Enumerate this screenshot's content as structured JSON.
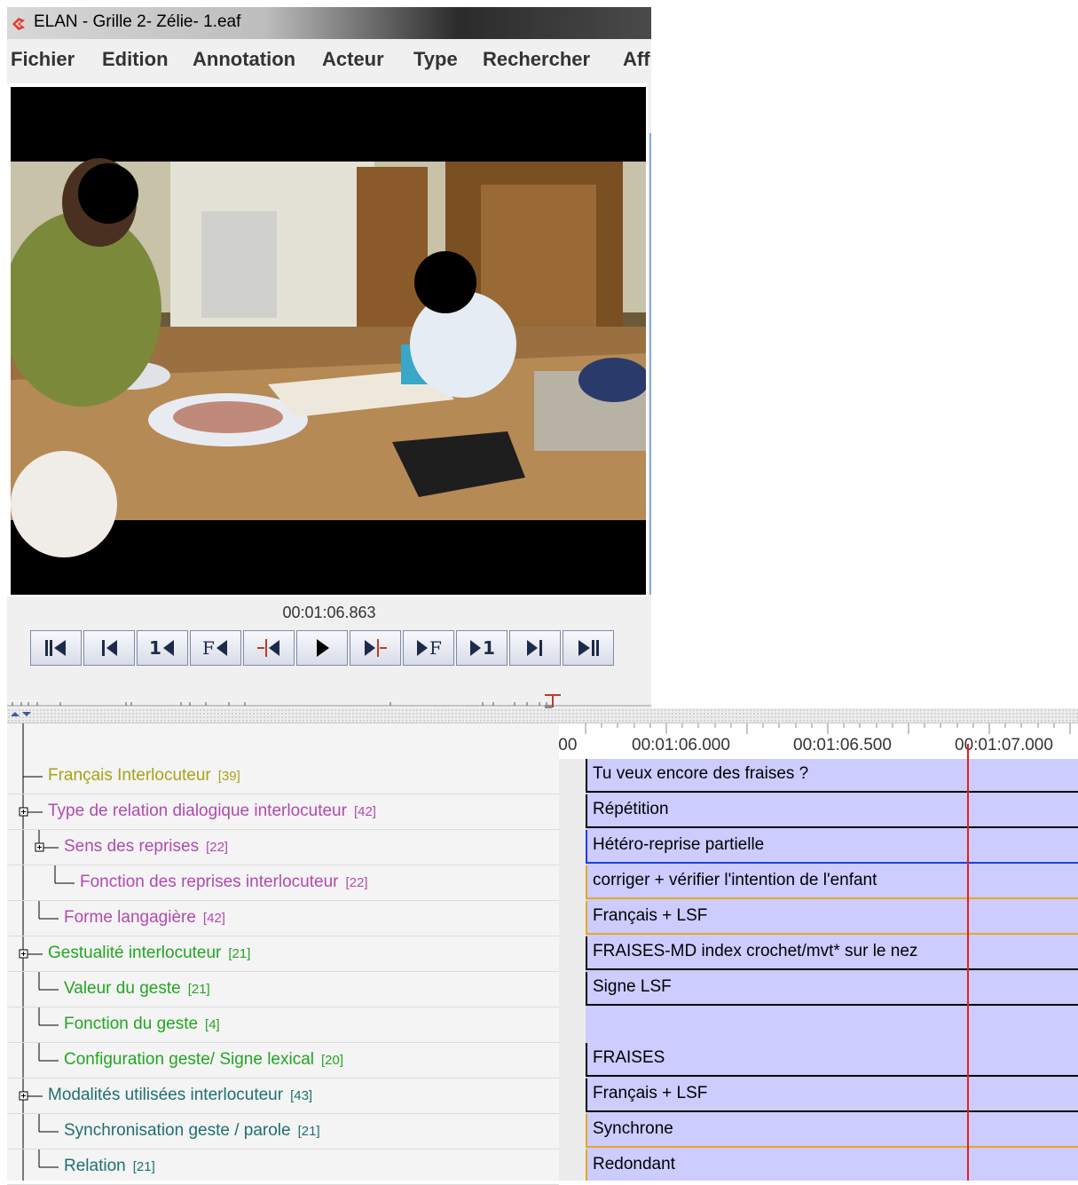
{
  "window": {
    "title": "ELAN - Grille 2- Zélie- 1.eaf",
    "icon": "elan-app-icon"
  },
  "menu": [
    {
      "label": "Fichier"
    },
    {
      "label": "Edition"
    },
    {
      "label": "Annotation"
    },
    {
      "label": "Acteur"
    },
    {
      "label": "Type"
    },
    {
      "label": "Rechercher"
    },
    {
      "label": "Aff"
    }
  ],
  "player": {
    "time": "00:01:06.863",
    "buttons": [
      {
        "name": "go-to-begin-button",
        "icon": "skip-to-start"
      },
      {
        "name": "previous-scrollview-button",
        "icon": "step-back-bar"
      },
      {
        "name": "previous-pixel-button",
        "label": "1"
      },
      {
        "name": "previous-frame-button",
        "label": "F"
      },
      {
        "name": "play-selection-backward-button",
        "icon": "selection-back"
      },
      {
        "name": "play-button",
        "icon": "play"
      },
      {
        "name": "play-selection-button",
        "icon": "selection-forward"
      },
      {
        "name": "next-frame-button",
        "label": "F"
      },
      {
        "name": "next-pixel-button",
        "label": "1"
      },
      {
        "name": "next-scrollview-button",
        "icon": "step-forward-bar"
      },
      {
        "name": "go-to-end-button",
        "icon": "skip-to-end"
      }
    ]
  },
  "timeline": {
    "ruler_labels": [
      ":00",
      "00:01:06.000",
      "00:01:06.500",
      "00:01:07.000"
    ],
    "cursor_color": "#e02020"
  },
  "tiers": [
    {
      "name": "Français Interlocuteur",
      "count": "[39]",
      "color": "#a5a515",
      "level": 0,
      "expander": false,
      "annotation": "Tu veux encore des fraises ?",
      "underline": "#000000"
    },
    {
      "name": "Type de relation dialogique interlocuteur",
      "count": "[42]",
      "color": "#b04ab0",
      "level": 0,
      "expander": true,
      "annotation": "Répétition",
      "underline": "#000000"
    },
    {
      "name": "Sens des reprises",
      "count": "[22]",
      "color": "#b04ab0",
      "level": 1,
      "expander": true,
      "annotation": "Hétéro-reprise partielle",
      "underline": "#1f3fe0"
    },
    {
      "name": "Fonction des reprises interlocuteur",
      "count": "[22]",
      "color": "#b04ab0",
      "level": 2,
      "expander": false,
      "annotation": "corriger + vérifier l'intention de l'enfant",
      "underline": "#e8a820"
    },
    {
      "name": "Forme langagière",
      "count": "[42]",
      "color": "#b04ab0",
      "level": 1,
      "expander": false,
      "annotation": "Français + LSF",
      "underline": "#e8a820"
    },
    {
      "name": "Gestualité interlocuteur",
      "count": "[21]",
      "color": "#22a522",
      "level": 0,
      "expander": true,
      "annotation": "FRAISES-MD index crochet/mvt* sur le nez",
      "underline": "#000000"
    },
    {
      "name": "Valeur du geste",
      "count": "[21]",
      "color": "#22a522",
      "level": 1,
      "expander": false,
      "annotation": "Signe LSF",
      "underline": "#000000"
    },
    {
      "name": "Fonction du geste",
      "count": "[4]",
      "color": "#22a522",
      "level": 1,
      "expander": false,
      "annotation": "",
      "underline": ""
    },
    {
      "name": "Configuration geste/ Signe lexical",
      "count": "[20]",
      "color": "#22a522",
      "level": 1,
      "expander": false,
      "annotation": "FRAISES",
      "underline": "#000000"
    },
    {
      "name": "Modalités utilisées interlocuteur",
      "count": "[43]",
      "color": "#1f6f6f",
      "level": 0,
      "expander": true,
      "annotation": "Français + LSF",
      "underline": "#000000"
    },
    {
      "name": "Synchronisation geste / parole",
      "count": "[21]",
      "color": "#1f6f6f",
      "level": 1,
      "expander": false,
      "annotation": "Synchrone",
      "underline": "#e8a820"
    },
    {
      "name": "Relation",
      "count": "[21]",
      "color": "#1f6f6f",
      "level": 1,
      "expander": false,
      "annotation": "Redondant",
      "underline": "#e8a820"
    }
  ]
}
